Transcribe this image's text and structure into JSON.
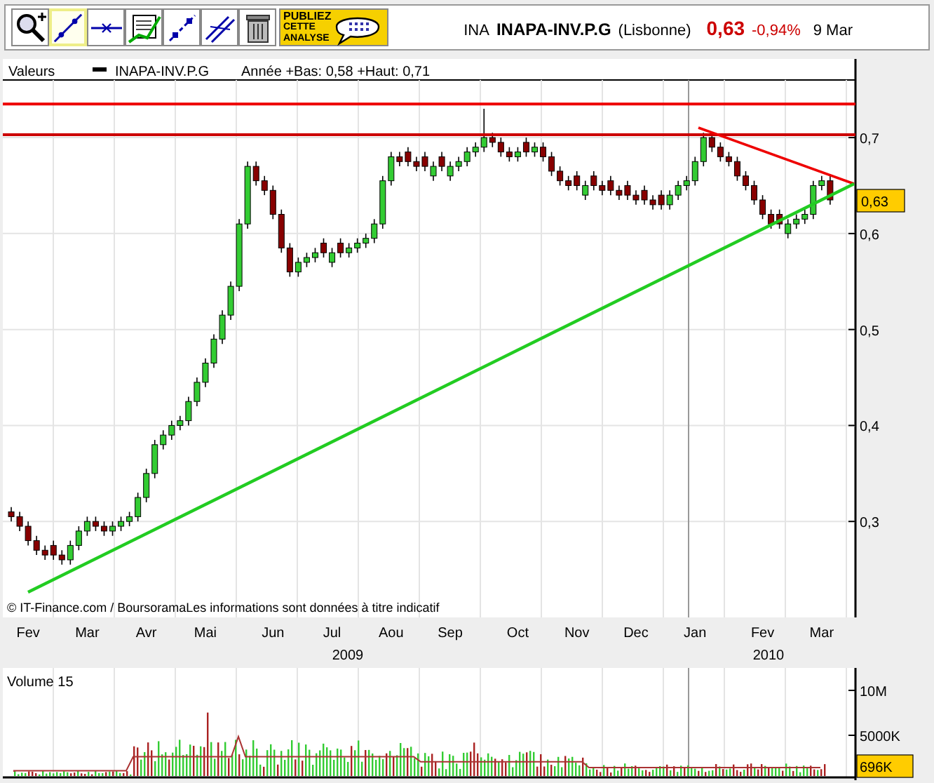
{
  "toolbar": {
    "tools": [
      {
        "kind": "zoom",
        "selected": false
      },
      {
        "kind": "trendline",
        "selected": true
      },
      {
        "kind": "horizontal",
        "selected": false
      },
      {
        "kind": "indicator",
        "selected": false
      },
      {
        "kind": "points",
        "selected": false
      },
      {
        "kind": "parallel",
        "selected": false
      },
      {
        "kind": "trash",
        "selected": false
      }
    ],
    "publish_lines": [
      "PUBLIEZ",
      "CETTE",
      "ANALYSE"
    ]
  },
  "quote": {
    "code": "INA",
    "name": "INAPA-INV.P.G",
    "market": "(Lisbonne)",
    "price": "0,63",
    "change": "-0,94%",
    "date": "9 Mar"
  },
  "price_chart": {
    "legend_label": "Valeurs",
    "series_name": "INAPA-INV.P.G",
    "range": "Année +Bas: 0,58 +Haut: 0,71",
    "last_price": "0,63",
    "credit": "© IT-Finance.com / BoursoramaLes informations sont données à titre indicatif",
    "chart_data": {
      "type": "candlestick",
      "categories": [
        null,
        null,
        "Fev",
        null,
        null,
        null,
        null,
        null,
        null,
        "Mar",
        null,
        null,
        null,
        null,
        null,
        null,
        "Avr",
        null,
        null,
        null,
        null,
        null,
        null,
        "Mai",
        null,
        null,
        null,
        null,
        null,
        null,
        null,
        "Jun",
        null,
        null,
        null,
        null,
        null,
        null,
        "Jul",
        null,
        null,
        null,
        null,
        null,
        null,
        "Aou",
        null,
        null,
        null,
        null,
        null,
        null,
        "Sep",
        null,
        null,
        null,
        null,
        null,
        null,
        null,
        "Oct",
        null,
        null,
        null,
        null,
        null,
        null,
        "Nov",
        null,
        null,
        null,
        null,
        null,
        null,
        "Dec",
        null,
        null,
        null,
        null,
        null,
        null,
        "Jan",
        null,
        null,
        null,
        null,
        null,
        null,
        null,
        "Fev",
        null,
        null,
        null,
        null,
        null,
        null,
        "Mar",
        null
      ],
      "ohlc": [
        [
          0.31,
          0.315,
          0.3,
          0.305
        ],
        [
          0.305,
          0.31,
          0.29,
          0.295
        ],
        [
          0.295,
          0.3,
          0.275,
          0.28
        ],
        [
          0.28,
          0.285,
          0.265,
          0.27
        ],
        [
          0.27,
          0.275,
          0.26,
          0.265
        ],
        [
          0.275,
          0.28,
          0.26,
          0.265
        ],
        [
          0.265,
          0.27,
          0.255,
          0.26
        ],
        [
          0.26,
          0.28,
          0.255,
          0.275
        ],
        [
          0.275,
          0.295,
          0.27,
          0.29
        ],
        [
          0.29,
          0.305,
          0.285,
          0.3
        ],
        [
          0.3,
          0.305,
          0.29,
          0.295
        ],
        [
          0.295,
          0.3,
          0.285,
          0.29
        ],
        [
          0.29,
          0.3,
          0.285,
          0.295
        ],
        [
          0.295,
          0.305,
          0.29,
          0.3
        ],
        [
          0.3,
          0.31,
          0.295,
          0.305
        ],
        [
          0.305,
          0.33,
          0.3,
          0.325
        ],
        [
          0.325,
          0.355,
          0.32,
          0.35
        ],
        [
          0.35,
          0.385,
          0.345,
          0.38
        ],
        [
          0.38,
          0.395,
          0.375,
          0.39
        ],
        [
          0.39,
          0.405,
          0.385,
          0.4
        ],
        [
          0.4,
          0.41,
          0.395,
          0.405
        ],
        [
          0.405,
          0.43,
          0.4,
          0.425
        ],
        [
          0.425,
          0.45,
          0.42,
          0.445
        ],
        [
          0.445,
          0.47,
          0.44,
          0.465
        ],
        [
          0.465,
          0.495,
          0.46,
          0.49
        ],
        [
          0.49,
          0.52,
          0.485,
          0.515
        ],
        [
          0.515,
          0.55,
          0.51,
          0.545
        ],
        [
          0.545,
          0.615,
          0.54,
          0.61
        ],
        [
          0.61,
          0.675,
          0.605,
          0.67
        ],
        [
          0.67,
          0.675,
          0.65,
          0.655
        ],
        [
          0.655,
          0.66,
          0.64,
          0.645
        ],
        [
          0.645,
          0.65,
          0.615,
          0.62
        ],
        [
          0.62,
          0.625,
          0.58,
          0.585
        ],
        [
          0.585,
          0.59,
          0.555,
          0.56
        ],
        [
          0.56,
          0.575,
          0.555,
          0.57
        ],
        [
          0.57,
          0.58,
          0.565,
          0.575
        ],
        [
          0.575,
          0.585,
          0.57,
          0.58
        ],
        [
          0.59,
          0.595,
          0.575,
          0.58
        ],
        [
          0.57,
          0.585,
          0.565,
          0.58
        ],
        [
          0.59,
          0.595,
          0.575,
          0.58
        ],
        [
          0.58,
          0.59,
          0.575,
          0.585
        ],
        [
          0.585,
          0.595,
          0.58,
          0.59
        ],
        [
          0.59,
          0.6,
          0.585,
          0.595
        ],
        [
          0.595,
          0.615,
          0.59,
          0.61
        ],
        [
          0.61,
          0.66,
          0.605,
          0.655
        ],
        [
          0.655,
          0.685,
          0.65,
          0.68
        ],
        [
          0.68,
          0.685,
          0.67,
          0.675
        ],
        [
          0.685,
          0.69,
          0.67,
          0.675
        ],
        [
          0.675,
          0.68,
          0.665,
          0.67
        ],
        [
          0.68,
          0.685,
          0.665,
          0.67
        ],
        [
          0.66,
          0.675,
          0.655,
          0.67
        ],
        [
          0.68,
          0.685,
          0.665,
          0.67
        ],
        [
          0.66,
          0.675,
          0.655,
          0.67
        ],
        [
          0.67,
          0.68,
          0.665,
          0.675
        ],
        [
          0.675,
          0.69,
          0.67,
          0.685
        ],
        [
          0.685,
          0.695,
          0.68,
          0.69
        ],
        [
          0.69,
          0.73,
          0.685,
          0.7
        ],
        [
          0.7,
          0.705,
          0.69,
          0.695
        ],
        [
          0.695,
          0.7,
          0.68,
          0.685
        ],
        [
          0.685,
          0.69,
          0.675,
          0.68
        ],
        [
          0.68,
          0.69,
          0.675,
          0.685
        ],
        [
          0.695,
          0.7,
          0.68,
          0.685
        ],
        [
          0.685,
          0.695,
          0.68,
          0.69
        ],
        [
          0.69,
          0.695,
          0.675,
          0.68
        ],
        [
          0.68,
          0.685,
          0.66,
          0.665
        ],
        [
          0.665,
          0.67,
          0.65,
          0.655
        ],
        [
          0.655,
          0.66,
          0.645,
          0.65
        ],
        [
          0.66,
          0.665,
          0.645,
          0.65
        ],
        [
          0.64,
          0.655,
          0.635,
          0.65
        ],
        [
          0.66,
          0.665,
          0.645,
          0.65
        ],
        [
          0.65,
          0.655,
          0.64,
          0.645
        ],
        [
          0.655,
          0.66,
          0.64,
          0.645
        ],
        [
          0.645,
          0.65,
          0.635,
          0.64
        ],
        [
          0.65,
          0.655,
          0.635,
          0.64
        ],
        [
          0.64,
          0.645,
          0.63,
          0.635
        ],
        [
          0.645,
          0.65,
          0.63,
          0.635
        ],
        [
          0.635,
          0.64,
          0.625,
          0.63
        ],
        [
          0.64,
          0.645,
          0.625,
          0.63
        ],
        [
          0.63,
          0.645,
          0.625,
          0.64
        ],
        [
          0.64,
          0.655,
          0.635,
          0.65
        ],
        [
          0.65,
          0.66,
          0.645,
          0.655
        ],
        [
          0.655,
          0.68,
          0.65,
          0.675
        ],
        [
          0.675,
          0.705,
          0.67,
          0.7
        ],
        [
          0.7,
          0.705,
          0.685,
          0.69
        ],
        [
          0.69,
          0.695,
          0.675,
          0.68
        ],
        [
          0.68,
          0.685,
          0.67,
          0.675
        ],
        [
          0.675,
          0.68,
          0.655,
          0.66
        ],
        [
          0.66,
          0.665,
          0.645,
          0.65
        ],
        [
          0.65,
          0.655,
          0.63,
          0.635
        ],
        [
          0.635,
          0.64,
          0.615,
          0.62
        ],
        [
          0.62,
          0.625,
          0.605,
          0.61
        ],
        [
          0.62,
          0.625,
          0.605,
          0.61
        ],
        [
          0.6,
          0.615,
          0.595,
          0.61
        ],
        [
          0.61,
          0.62,
          0.605,
          0.615
        ],
        [
          0.615,
          0.625,
          0.61,
          0.62
        ],
        [
          0.62,
          0.655,
          0.615,
          0.65
        ],
        [
          0.65,
          0.66,
          0.645,
          0.655
        ],
        [
          0.655,
          0.66,
          0.63,
          0.635
        ]
      ],
      "ylim": [
        0.2,
        0.76
      ],
      "grid": true,
      "ref_lines": [
        {
          "axis": "y",
          "value": 0.735,
          "color": "#ee0000"
        },
        {
          "axis": "y",
          "value": 0.703,
          "color": "#cc0000"
        }
      ],
      "yticks": [
        {
          "value": 0.7,
          "label": "0,7"
        },
        {
          "value": 0.6,
          "label": "0,6"
        },
        {
          "value": 0.5,
          "label": "0,5"
        },
        {
          "value": 0.4,
          "label": "0,4"
        },
        {
          "value": 0.3,
          "label": "0,3"
        }
      ]
    }
  },
  "years": [
    "2009",
    "2010"
  ],
  "volume_chart": {
    "title": "Volume 15",
    "yticks": [
      "10M",
      "5000K"
    ],
    "last_volume": "696K"
  }
}
